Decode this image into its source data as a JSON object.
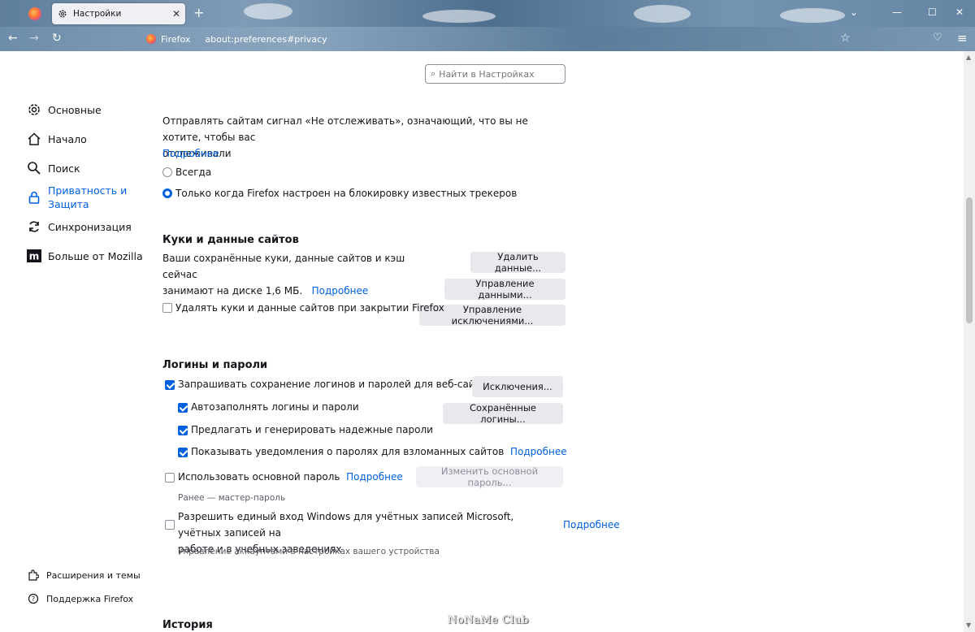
{
  "browser": {
    "tab_title": "Настройки",
    "identity_label": "Firefox",
    "url": "about:preferences#privacy"
  },
  "search": {
    "placeholder": "Найти в Настройках"
  },
  "sidebar": {
    "items": [
      {
        "label": "Основные",
        "icon": "gear-icon"
      },
      {
        "label": "Начало",
        "icon": "home-icon"
      },
      {
        "label": "Поиск",
        "icon": "search-icon"
      },
      {
        "label": "Приватность и Защита",
        "icon": "lock-icon",
        "active": true
      },
      {
        "label": "Синхронизация",
        "icon": "sync-icon"
      },
      {
        "label": "Больше от Mozilla",
        "icon": "mozilla-icon"
      }
    ],
    "footer": [
      {
        "label": "Расширения и темы",
        "icon": "puzzle-icon"
      },
      {
        "label": "Поддержка Firefox",
        "icon": "help-icon"
      }
    ]
  },
  "dnt": {
    "text_line1": "Отправлять сайтам сигнал «Не отслеживать», означающий, что вы не хотите, чтобы вас",
    "text_line2": "отслеживали",
    "learn_more": "Подробнее",
    "option_always": "Всегда",
    "option_only": "Только когда Firefox настроен на блокировку известных трекеров"
  },
  "cookies": {
    "heading": "Куки и данные сайтов",
    "desc_line1": "Ваши сохранённые куки, данные сайтов и кэш сейчас",
    "desc_line2": "занимают на диске 1,6 МБ.",
    "learn_more": "Подробнее",
    "btn_clear": "Удалить данные...",
    "btn_manage": "Управление данными...",
    "btn_exceptions": "Управление исключениями...",
    "delete_on_close": "Удалять куки и данные сайтов при закрытии Firefox"
  },
  "logins": {
    "heading": "Логины и пароли",
    "ask_save": "Запрашивать сохранение логинов и паролей для веб-сайтов",
    "autofill": "Автозаполнять логины и пароли",
    "suggest": "Предлагать и генерировать надежные пароли",
    "breach_alerts": "Показывать уведомления о паролях для взломанных сайтов",
    "breach_learn_more": "Подробнее",
    "primary_password": "Использовать основной пароль",
    "primary_learn_more": "Подробнее",
    "primary_note": "Ранее — мастер-пароль",
    "windows_sso_line1": "Разрешить единый вход Windows для учётных записей Microsoft, учётных записей на",
    "windows_sso_line2": "работе и в учебных заведениях",
    "windows_sso_learn_more": "Подробнее",
    "windows_sso_note": "Управление аккаунтами в настройках вашего устройства",
    "btn_exceptions": "Исключения...",
    "btn_saved_logins": "Сохранённые логины...",
    "btn_change_primary": "Изменить основной пароль..."
  },
  "history": {
    "heading": "История"
  },
  "watermark": "NoNaMe Club"
}
